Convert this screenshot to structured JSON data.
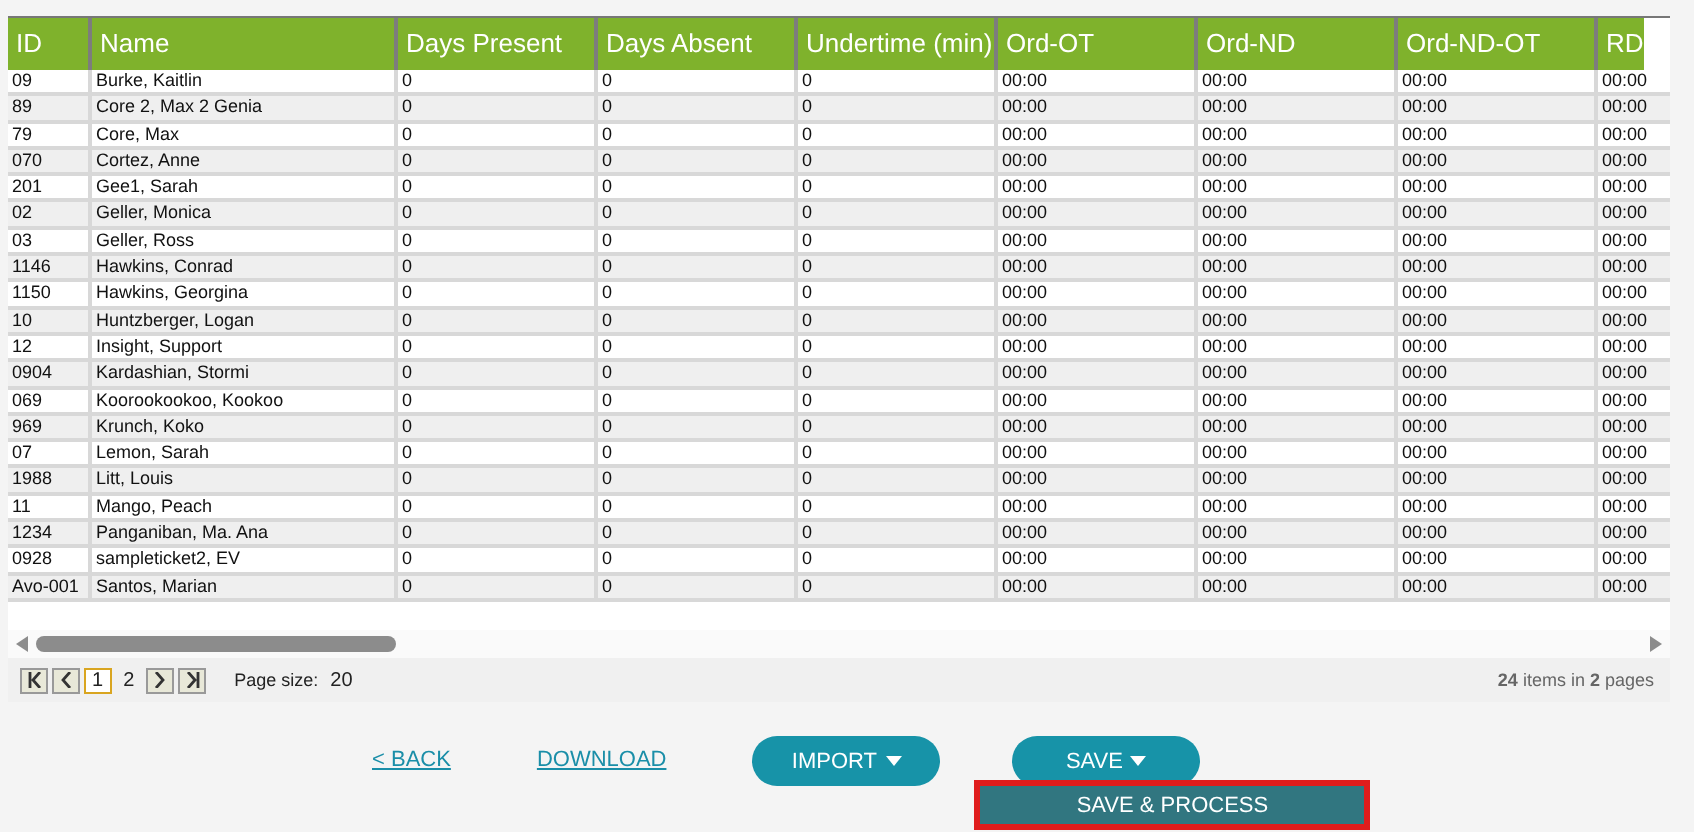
{
  "table": {
    "columns": [
      "ID",
      "Name",
      "Days Present",
      "Days Absent",
      "Undertime (min)",
      "Ord-OT",
      "Ord-ND",
      "Ord-ND-OT",
      "RD"
    ],
    "rows": [
      [
        "09",
        "Burke, Kaitlin",
        "0",
        "0",
        "0",
        "00:00",
        "00:00",
        "00:00",
        "00:00"
      ],
      [
        "89",
        "Core 2, Max 2 Genia",
        "0",
        "0",
        "0",
        "00:00",
        "00:00",
        "00:00",
        "00:00"
      ],
      [
        "79",
        "Core, Max",
        "0",
        "0",
        "0",
        "00:00",
        "00:00",
        "00:00",
        "00:00"
      ],
      [
        "070",
        "Cortez, Anne",
        "0",
        "0",
        "0",
        "00:00",
        "00:00",
        "00:00",
        "00:00"
      ],
      [
        "201",
        "Gee1, Sarah",
        "0",
        "0",
        "0",
        "00:00",
        "00:00",
        "00:00",
        "00:00"
      ],
      [
        "02",
        "Geller, Monica",
        "0",
        "0",
        "0",
        "00:00",
        "00:00",
        "00:00",
        "00:00"
      ],
      [
        "03",
        "Geller, Ross",
        "0",
        "0",
        "0",
        "00:00",
        "00:00",
        "00:00",
        "00:00"
      ],
      [
        "1146",
        "Hawkins, Conrad",
        "0",
        "0",
        "0",
        "00:00",
        "00:00",
        "00:00",
        "00:00"
      ],
      [
        "1150",
        "Hawkins, Georgina",
        "0",
        "0",
        "0",
        "00:00",
        "00:00",
        "00:00",
        "00:00"
      ],
      [
        "10",
        "Huntzberger, Logan",
        "0",
        "0",
        "0",
        "00:00",
        "00:00",
        "00:00",
        "00:00"
      ],
      [
        "12",
        "Insight, Support",
        "0",
        "0",
        "0",
        "00:00",
        "00:00",
        "00:00",
        "00:00"
      ],
      [
        "0904",
        "Kardashian, Stormi",
        "0",
        "0",
        "0",
        "00:00",
        "00:00",
        "00:00",
        "00:00"
      ],
      [
        "069",
        "Koorookookoo, Kookoo",
        "0",
        "0",
        "0",
        "00:00",
        "00:00",
        "00:00",
        "00:00"
      ],
      [
        "969",
        "Krunch, Koko",
        "0",
        "0",
        "0",
        "00:00",
        "00:00",
        "00:00",
        "00:00"
      ],
      [
        "07",
        "Lemon, Sarah",
        "0",
        "0",
        "0",
        "00:00",
        "00:00",
        "00:00",
        "00:00"
      ],
      [
        "1988",
        "Litt, Louis",
        "0",
        "0",
        "0",
        "00:00",
        "00:00",
        "00:00",
        "00:00"
      ],
      [
        "11",
        "Mango, Peach",
        "0",
        "0",
        "0",
        "00:00",
        "00:00",
        "00:00",
        "00:00"
      ],
      [
        "1234",
        "Panganiban, Ma. Ana",
        "0",
        "0",
        "0",
        "00:00",
        "00:00",
        "00:00",
        "00:00"
      ],
      [
        "0928",
        "sampleticket2, EV",
        "0",
        "0",
        "0",
        "00:00",
        "00:00",
        "00:00",
        "00:00"
      ],
      [
        "Avo-001",
        "Santos, Marian",
        "0",
        "0",
        "0",
        "00:00",
        "00:00",
        "00:00",
        "00:00"
      ]
    ]
  },
  "pager": {
    "pages": [
      {
        "label": "1",
        "selected": true
      },
      {
        "label": "2",
        "selected": false
      }
    ],
    "page_size_label": "Page size:",
    "page_size": "20",
    "summary": "**24** items in **2** pages"
  },
  "actions": {
    "links": [
      "< BACK",
      "DOWNLOAD"
    ],
    "buttons": [
      {
        "label": "IMPORT"
      },
      {
        "label": "SAVE",
        "menu": [
          {
            "label": "SAVE & PROCESS",
            "highlighted": true
          }
        ]
      }
    ]
  }
}
